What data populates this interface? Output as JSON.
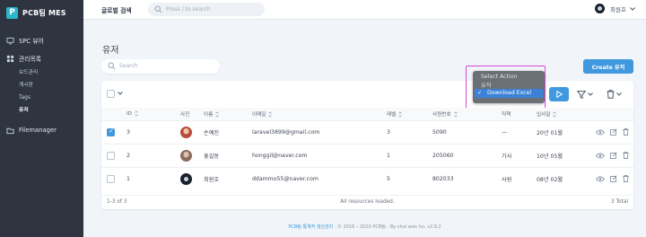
{
  "brand": {
    "logo_letter": "P",
    "name": "PCB팀 MES"
  },
  "sidebar": {
    "spc": "SPC 뷰어",
    "admin": "관리목록",
    "admin_items": [
      "보드관리",
      "게시판",
      "Tags",
      "유저"
    ],
    "active_item": "유저",
    "filemanager": "Filemanager"
  },
  "topbar": {
    "title": "글로벌 검색",
    "search_placeholder": "Press / to search",
    "user_name": "최원호"
  },
  "page": {
    "title": "유저",
    "search_placeholder": "Search",
    "create_button": "Create 유저"
  },
  "actions": {
    "dropdown_header": "Select Action",
    "dropdown_group": "유저",
    "dropdown_selected": "Download Excel",
    "check_mark": "✓"
  },
  "table": {
    "columns": [
      "ID",
      "사진",
      "이름",
      "이메일",
      "레벨",
      "사원번호",
      "직책",
      "입사일"
    ],
    "rows": [
      {
        "id": "3",
        "name": "손예진",
        "email": "laravel3899@gmail.com",
        "level": "3",
        "emp_no": "5090",
        "position": "—",
        "joined": "20년 01월",
        "checked": true,
        "avatar_color": "#b94a3e"
      },
      {
        "id": "2",
        "name": "홍길동",
        "email": "honggil@naver.com",
        "level": "1",
        "emp_no": "205060",
        "position": "기사",
        "joined": "10년 05월",
        "checked": false,
        "avatar_color": "#8c6b5d"
      },
      {
        "id": "1",
        "name": "최원호",
        "email": "ddammo55@naver.com",
        "level": "5",
        "emp_no": "802033",
        "position": "사원",
        "joined": "08년 02월",
        "checked": false,
        "avatar_color": "#1a202c"
      }
    ]
  },
  "footer": {
    "pagination": "1-3 of 3",
    "status": "All resources loaded.",
    "total": "3 Total"
  },
  "page_footer": {
    "link": "PCB팀 통계적 생산관리",
    "text": "· © 2016 – 2020 PCB팀 - By choi won ho.    v2.9.2"
  },
  "colors": {
    "accent": "#4099de",
    "sidebar_bg": "#2e3440",
    "highlight": "#d946d2"
  }
}
